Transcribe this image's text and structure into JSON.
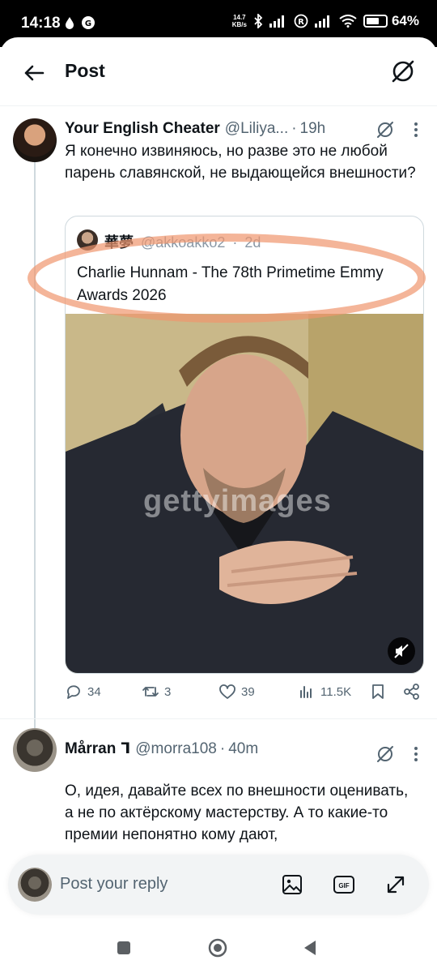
{
  "status_bar": {
    "time": "14:18",
    "net_speed_top": "14.7",
    "net_speed_bottom": "KB/s",
    "battery": "64%"
  },
  "header": {
    "title": "Post"
  },
  "main_post": {
    "author": "Your English Cheater",
    "handle": "@Liliya...",
    "separator": "·",
    "time": "19h",
    "text": "Я конечно извиняюсь, но разве это не любой парень славянской, не выдающейся внешности?"
  },
  "quoted_post": {
    "author": "華夢",
    "handle": "@akkoakko2",
    "separator": "·",
    "time": "2d",
    "text": "Charlie Hunnam - The 78th Primetime Emmy Awards 2026",
    "media_watermark": "gettyimages"
  },
  "actions": {
    "replies": "34",
    "reposts": "3",
    "likes": "39",
    "views": "11.5K"
  },
  "reply_post": {
    "author": "Mårran",
    "author_suffix": "ᒣ",
    "handle": "@morra108",
    "separator": "·",
    "time": "40m",
    "text": "О, идея, давайте всех по внешности оценивать, а не по актёрскому мастерству. А то какие-то премии непонятно кому дают,"
  },
  "composer": {
    "placeholder": "Post your reply",
    "gif_label": "GIF"
  },
  "colors": {
    "text_primary": "#0f1419",
    "text_secondary": "#536471",
    "annotation": "#f0966e"
  }
}
